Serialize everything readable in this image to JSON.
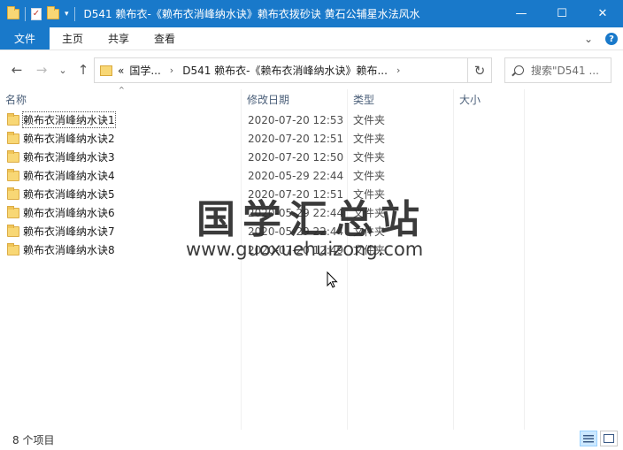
{
  "window": {
    "title": "D541 赖布衣-《赖布衣消峰纳水诀》赖布衣拨砂诀 黄石公辅星水法风水",
    "controls": {
      "minimize": "—",
      "maximize": "☐",
      "close": "✕"
    }
  },
  "quick_access": {
    "dropdown": "▾"
  },
  "ribbon": {
    "tabs": [
      "文件",
      "主页",
      "共享",
      "查看"
    ],
    "expand": "⌄",
    "help": "?"
  },
  "nav": {
    "back": "←",
    "forward": "→",
    "recent": "⌄",
    "up": "↑",
    "refresh": "↻"
  },
  "address": {
    "overflow": "«",
    "crumbs": [
      "国学...",
      "D541 赖布衣-《赖布衣消峰纳水诀》赖布..."
    ],
    "separator": "›"
  },
  "search": {
    "placeholder": "搜索\"D541 ..."
  },
  "columns": {
    "name": "名称",
    "date": "修改日期",
    "type": "类型",
    "size": "大小",
    "sort_arrow": "^"
  },
  "files": [
    {
      "name": "赖布衣消峰纳水诀1",
      "date": "2020-07-20 12:53",
      "type": "文件夹"
    },
    {
      "name": "赖布衣消峰纳水诀2",
      "date": "2020-07-20 12:51",
      "type": "文件夹"
    },
    {
      "name": "赖布衣消峰纳水诀3",
      "date": "2020-07-20 12:50",
      "type": "文件夹"
    },
    {
      "name": "赖布衣消峰纳水诀4",
      "date": "2020-05-29 22:44",
      "type": "文件夹"
    },
    {
      "name": "赖布衣消峰纳水诀5",
      "date": "2020-07-20 12:51",
      "type": "文件夹"
    },
    {
      "name": "赖布衣消峰纳水诀6",
      "date": "2020-05-29 22:44",
      "type": "文件夹"
    },
    {
      "name": "赖布衣消峰纳水诀7",
      "date": "2020-05-29 22:44",
      "type": "文件夹"
    },
    {
      "name": "赖布衣消峰纳水诀8",
      "date": "2020-07-20 12:49",
      "type": "文件夹"
    }
  ],
  "watermark": {
    "title": "国学汇总站",
    "url": "www.guoxuehuizong.com"
  },
  "status": {
    "count": "8 个项目"
  },
  "colors": {
    "accent": "#1979ca",
    "folder": "#f8d775"
  }
}
